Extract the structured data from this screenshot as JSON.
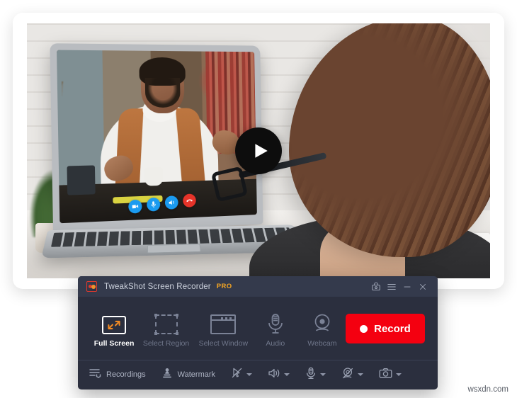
{
  "app": {
    "title": "TweakShot Screen Recorder",
    "badge": "PRO",
    "icon": "tweakshot-app-icon"
  },
  "titlebar": {
    "controls": [
      {
        "name": "screenshot-camera-icon",
        "label": ""
      },
      {
        "name": "hamburger-menu-icon",
        "label": ""
      },
      {
        "name": "minimize-icon",
        "label": ""
      },
      {
        "name": "close-icon",
        "label": ""
      }
    ]
  },
  "modes": [
    {
      "label": "Full Screen",
      "icon": "fullscreen-icon",
      "active": true
    },
    {
      "label": "Select Region",
      "icon": "select-region-icon",
      "active": false
    },
    {
      "label": "Select Window",
      "icon": "select-window-icon",
      "active": false
    },
    {
      "label": "Audio",
      "icon": "microphone-icon",
      "active": false
    },
    {
      "label": "Webcam",
      "icon": "webcam-icon",
      "active": false
    }
  ],
  "record": {
    "label": "Record",
    "color": "#f40010"
  },
  "bottombar": {
    "recordings_label": "Recordings",
    "recordings_icon": "recordings-list-icon",
    "watermark_label": "Watermark",
    "watermark_icon": "watermark-stamp-icon",
    "controls": [
      {
        "name": "cursor-off-icon",
        "has_caret": true
      },
      {
        "name": "speaker-icon",
        "has_caret": true
      },
      {
        "name": "microphone-icon",
        "has_caret": true
      },
      {
        "name": "webcam-off-icon",
        "has_caret": true
      },
      {
        "name": "camera-icon",
        "has_caret": true
      }
    ]
  },
  "photo": {
    "play_button": "play-icon",
    "video_call_controls": [
      {
        "name": "call-video-icon",
        "color": "#1b9bf0"
      },
      {
        "name": "call-mic-icon",
        "color": "#1b9bf0"
      },
      {
        "name": "call-speaker-icon",
        "color": "#1b9bf0"
      },
      {
        "name": "call-hangup-icon",
        "color": "#e63329"
      }
    ]
  },
  "watermark": {
    "text": "wsxdn.com"
  },
  "colors": {
    "panel_bg": "#2b2f3e",
    "titlebar_bg": "#343a4c",
    "accent_orange": "#f5a623",
    "record_red": "#f40010",
    "label_muted": "#6f768a",
    "label_active": "#ffffff"
  }
}
